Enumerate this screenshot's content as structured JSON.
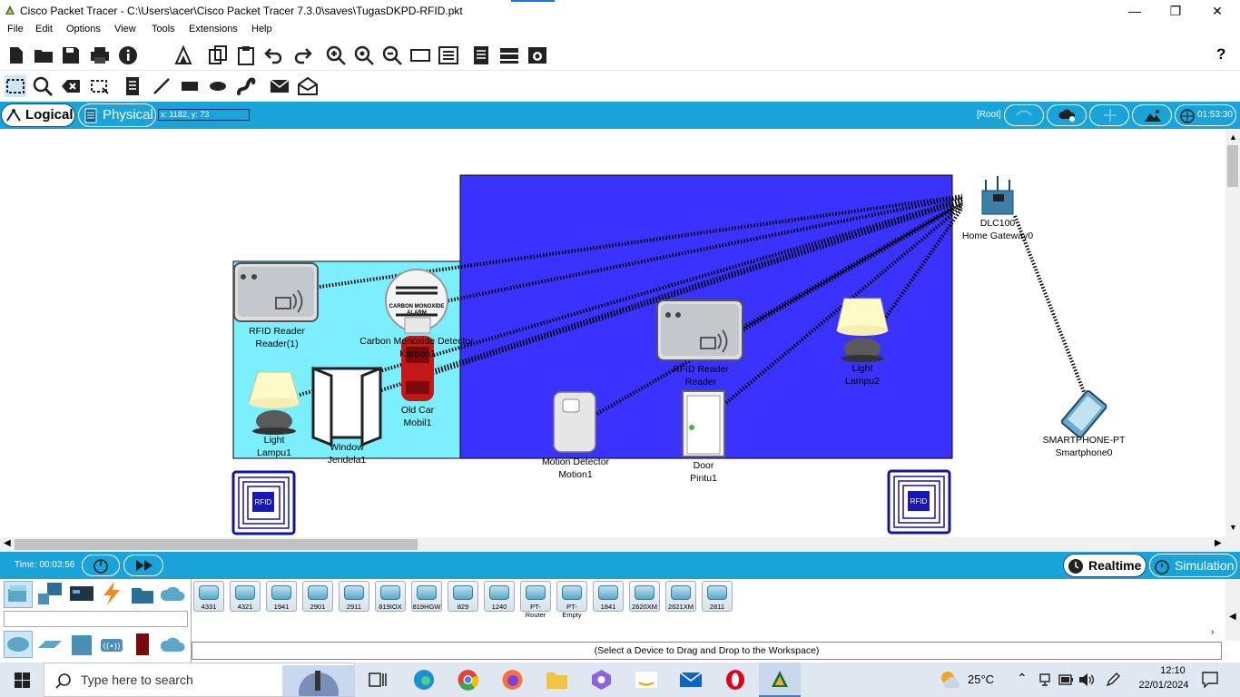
{
  "window": {
    "title": "Cisco Packet Tracer - C:\\Users\\acer\\Cisco Packet Tracer 7.3.0\\saves\\TugasDKPD-RFID.pkt",
    "minimize": "—",
    "maximize": "❐",
    "close": "✕"
  },
  "menu": [
    "File",
    "Edit",
    "Options",
    "View",
    "Tools",
    "Extensions",
    "Help"
  ],
  "help_mark": "?",
  "modebar": {
    "logical": "Logical",
    "physical": "Physical",
    "coordinates": "x: 1182, y: 73",
    "root": "[Root]",
    "clock": "01:53:30"
  },
  "workspace": {
    "devices": [
      {
        "type": "RFID Reader",
        "name": "Reader(1)"
      },
      {
        "type": "Carbon Monoxide Detector",
        "name": "Karbon1"
      },
      {
        "type": "Light",
        "name": "Lampu1"
      },
      {
        "type": "Window",
        "name": "Jendela1"
      },
      {
        "type": "Old Car",
        "name": "Mobil1"
      },
      {
        "type": "RFID Reader",
        "name": "Reader"
      },
      {
        "type": "Motion Detector",
        "name": "Motion1"
      },
      {
        "type": "Door",
        "name": "Pintu1"
      },
      {
        "type": "Light",
        "name": "Lampu2"
      },
      {
        "type": "DLC100",
        "name": "Home Gateway0"
      },
      {
        "type": "SMARTPHONE-PT",
        "name": "Smartphone0"
      }
    ],
    "co_alarm_text_1": "CARBON MONOXIDE",
    "co_alarm_text_2": "ALARM",
    "rfid_tag_text": "RFID"
  },
  "timebar": {
    "time": "Time: 00:03:56",
    "realtime": "Realtime",
    "simulation": "Simulation"
  },
  "device_models": [
    "4331",
    "4321",
    "1941",
    "2901",
    "2911",
    "819IOX",
    "819HGW",
    "829",
    "1240",
    "PT-Router",
    "PT-Empty",
    "1841",
    "2620XM",
    "2621XM",
    "2811"
  ],
  "status_hint": "(Select a Device to Drag and Drop to the Workspace)",
  "taskbar": {
    "search_placeholder": "Type here to search",
    "weather": "25°C",
    "time": "12:10",
    "date": "22/01/2024"
  },
  "colors": {
    "accent": "#1aa3d9",
    "blue_room": "#3a33ff",
    "cyan_room": "#7cefff"
  }
}
